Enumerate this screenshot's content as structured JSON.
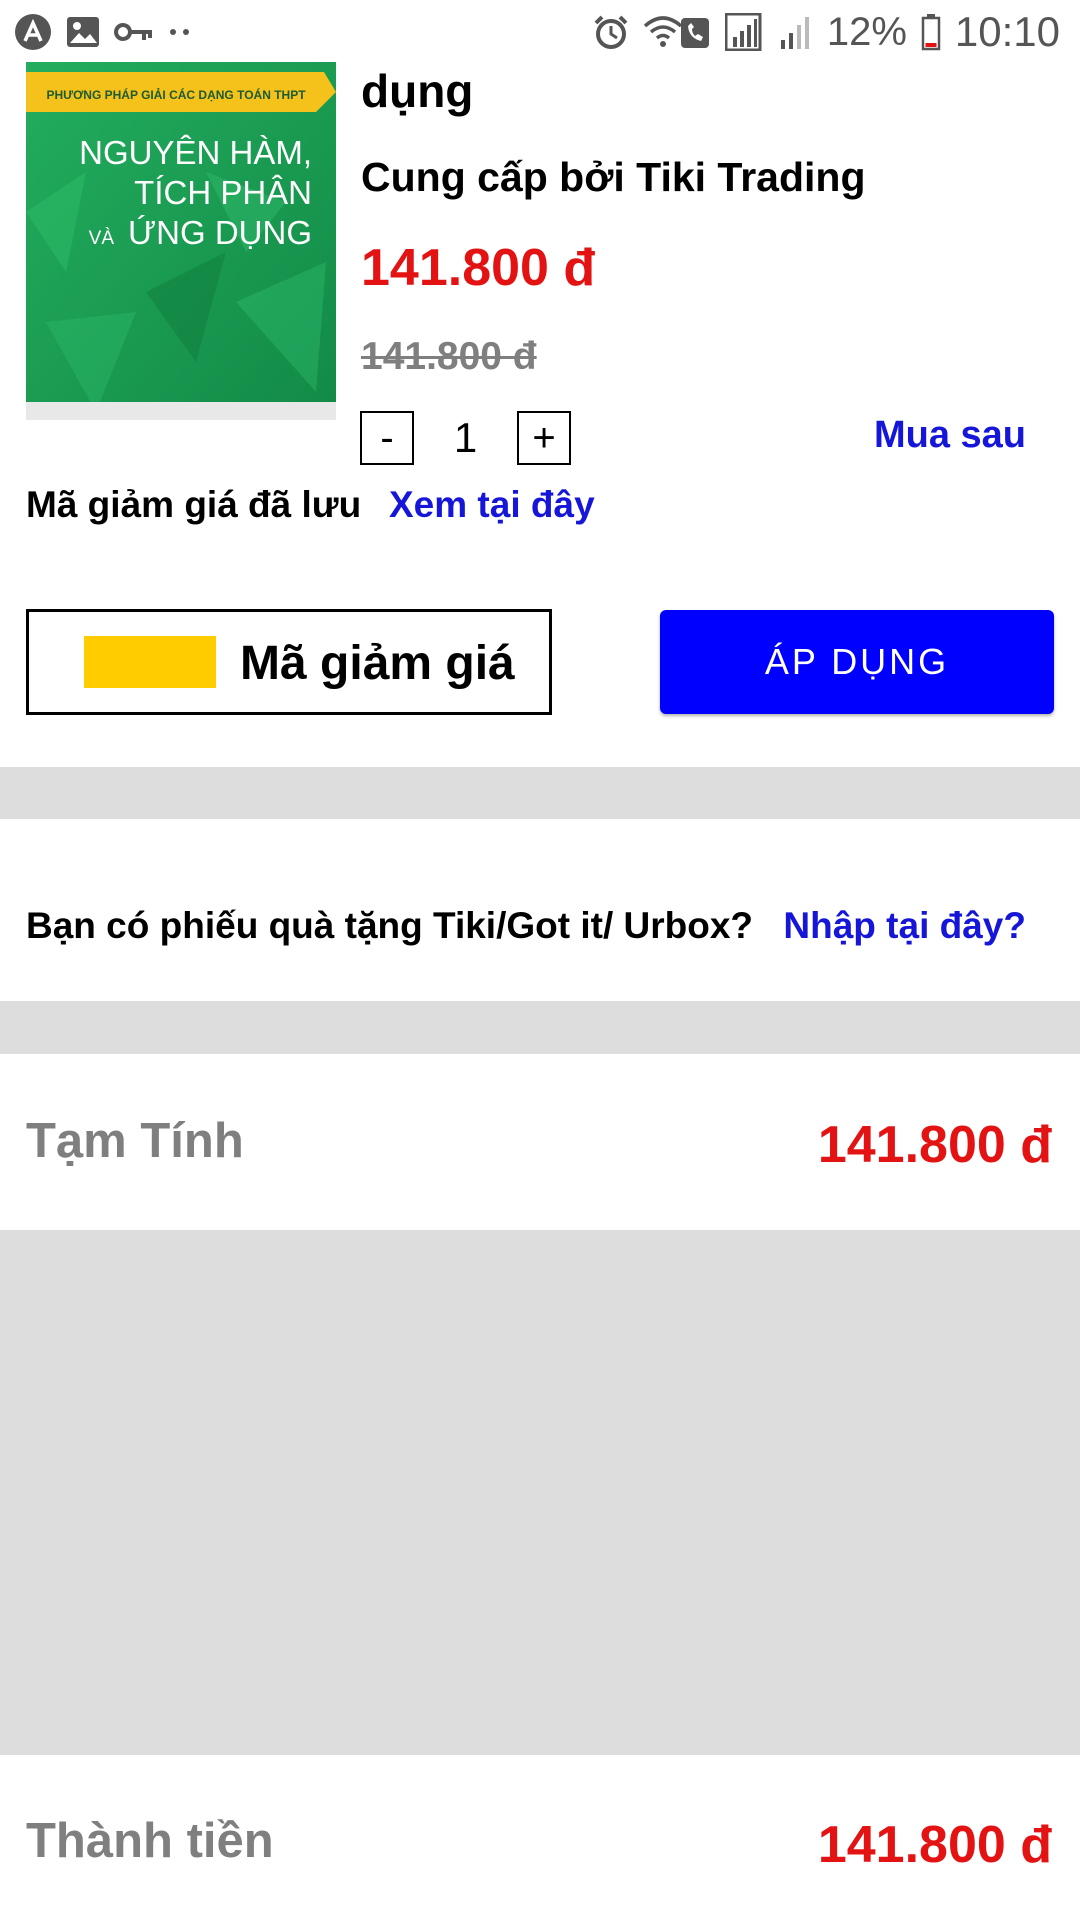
{
  "status_bar": {
    "battery_percent": "12%",
    "time": "10:10",
    "left_icons": [
      "app-notification-icon",
      "image-icon",
      "key-icon",
      "more-dots-icon"
    ],
    "right_icons": [
      "alarm-icon",
      "wifi-calling-icon",
      "signal-icon",
      "signal-icon",
      "battery-icon"
    ]
  },
  "product": {
    "image": {
      "series_line": "PHƯƠNG PHÁP GIẢI CÁC DẠNG TOÁN THPT",
      "line1": "NGUYÊN HÀM,",
      "line2": "TÍCH PHÂN",
      "line3_small": "VÀ",
      "line3": "ỨNG DỤNG"
    },
    "title_tail": "dụng",
    "seller": "Cung cấp bởi Tiki Trading",
    "price": "141.800 đ",
    "original_price": "141.800 đ",
    "quantity": {
      "minus": "-",
      "value": "1",
      "plus": "+"
    },
    "buy_later": "Mua sau"
  },
  "saved_coupon": {
    "label": "Mã giảm giá đã lưu",
    "link": "Xem tại đây"
  },
  "coupon": {
    "label": "Mã giảm giá",
    "swatch_color": "#ffcc00",
    "apply_button": "ÁP DỤNG"
  },
  "gift_card": {
    "label": "Bạn có phiếu quà tặng Tiki/Got it/ Urbox?",
    "link": "Nhập tại đây?"
  },
  "summary": {
    "subtotal_label": "Tạm Tính",
    "subtotal_value": "141.800 đ",
    "total_label": "Thành tiền",
    "total_value": "141.800 đ"
  },
  "colors": {
    "price_red": "#e31313",
    "link_blue": "#1616d8",
    "button_blue": "#0000ff",
    "divider_gray": "#dddddd",
    "cover_green": "#1fa558",
    "cover_banner": "#f4c21b"
  }
}
